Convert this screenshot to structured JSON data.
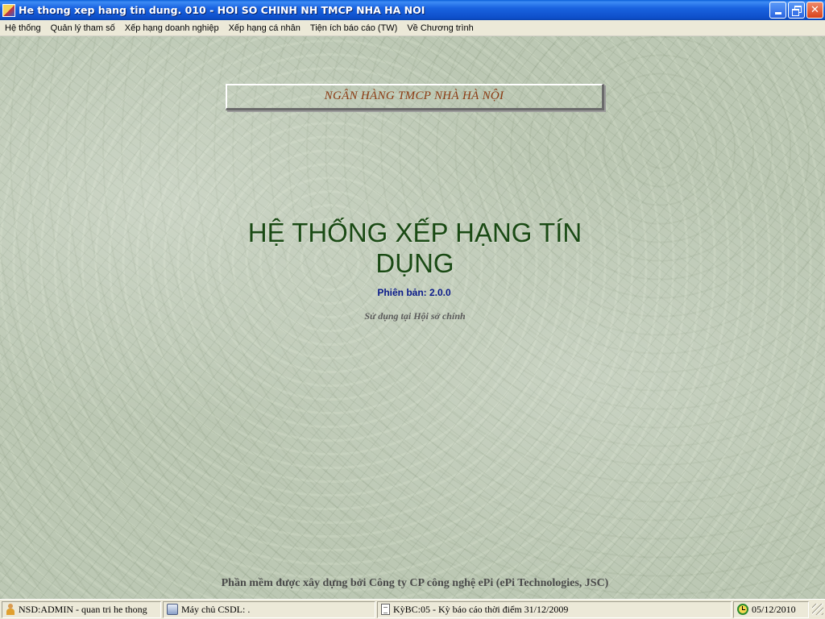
{
  "window": {
    "title": "He thong xep hang tin dung. 010 - HOI SO CHINH NH TMCP NHA HA NOI",
    "minimize_label": "",
    "restore_label": "",
    "close_label": "✕"
  },
  "menu": {
    "items": [
      "Hệ thống",
      "Quản lý tham số",
      "Xếp hạng doanh nghiệp",
      "Xếp hạng cá nhân",
      "Tiện ích báo cáo (TW)",
      "Về Chương trình"
    ]
  },
  "main": {
    "bank_name": "NGÂN HÀNG TMCP NHÀ HÀ NỘI",
    "title": "HỆ THỐNG XẾP HẠNG TÍN DỤNG",
    "version": "Phiên bản: 2.0.0",
    "usage": "Sử dụng tại Hội sở chính",
    "credit": "Phần mềm được xây dựng bởi Công ty CP công nghệ ePi (ePi Technologies, JSC)"
  },
  "status": {
    "user": "NSD:ADMIN - quan tri he thong",
    "db_server": "Máy chủ CSDL: .",
    "report_period": "KỳBC:05 - Kỳ báo cáo thời điểm 31/12/2009",
    "date": "05/12/2010"
  },
  "colors": {
    "titlebar": "#0d4ec8",
    "bank_name": "#8b3a12",
    "main_title": "#1a4a14",
    "version": "#0a1a8a"
  },
  "icons": {
    "app": "app-icon",
    "user": "user-icon",
    "db": "database-icon",
    "report": "document-icon",
    "date": "clock-icon"
  }
}
